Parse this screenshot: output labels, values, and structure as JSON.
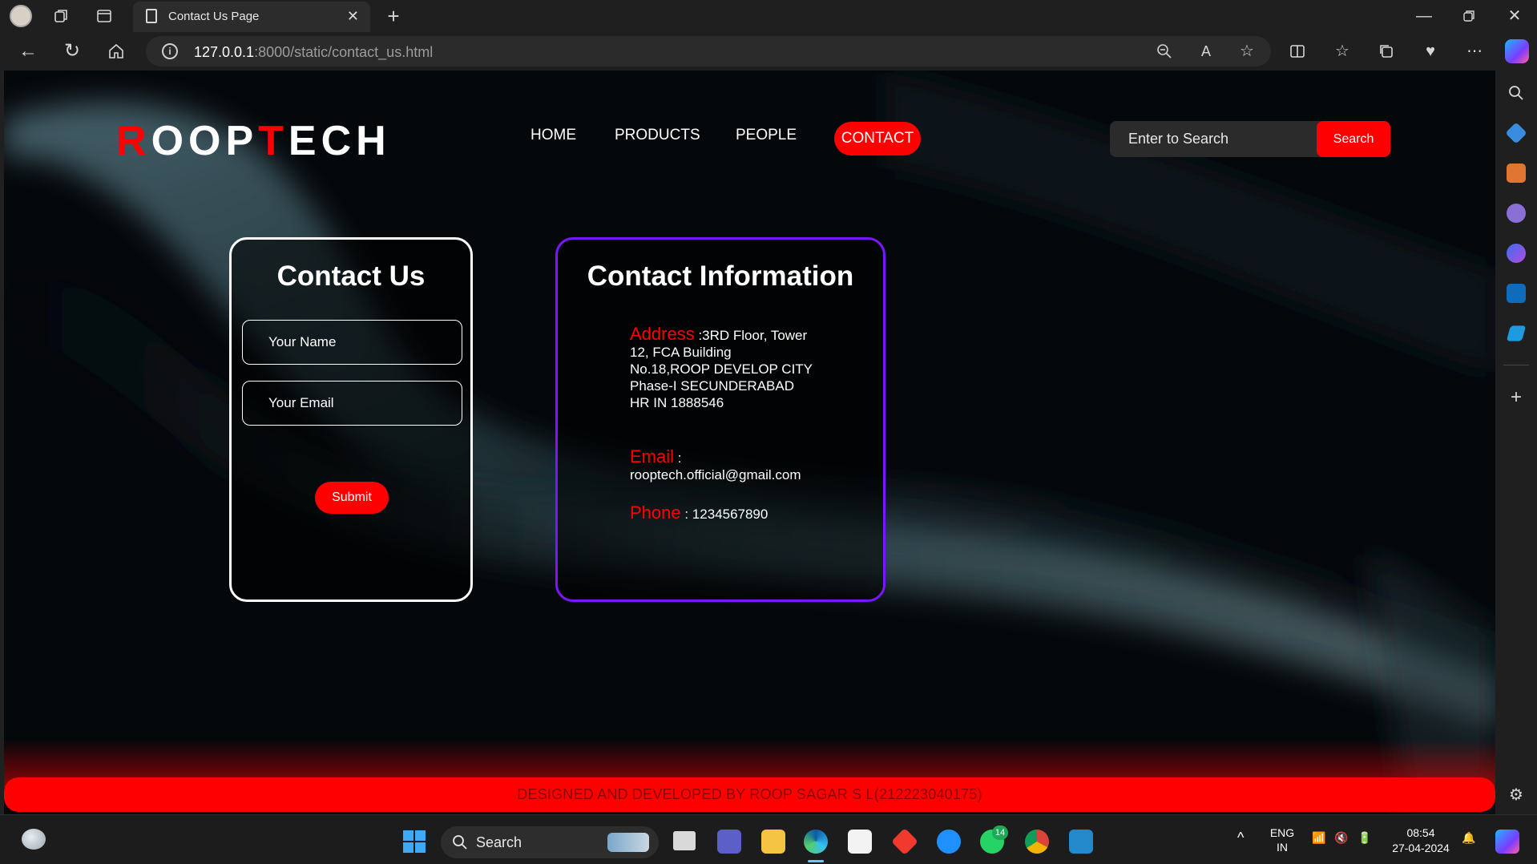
{
  "browser": {
    "tab_title": "Contact Us Page",
    "url_host": "127.0.0.1",
    "url_rest": ":8000/static/contact_us.html"
  },
  "page": {
    "logo_first": "R",
    "logo_mid1": "OOP",
    "logo_red2": "T",
    "logo_rest": "ECH",
    "nav": {
      "home": "HOME",
      "products": "PRODUCTS",
      "people": "PEOPLE",
      "contact": "CONTACT"
    },
    "search": {
      "placeholder": "Enter to Search",
      "button": "Search"
    },
    "contact_form": {
      "title": "Contact Us",
      "name_placeholder": "Your Name",
      "email_placeholder": "Your Email",
      "submit": "Submit"
    },
    "contact_info": {
      "title": "Contact Information",
      "address_label": "Address",
      "address_value": " :3RD Floor, Tower 12, FCA Building No.18,ROOP DEVELOP CITY Phase-I SECUNDERABAD HR IN 1888546",
      "email_label": "Email",
      "email_sep": " :",
      "email_value": "rooptech.official@gmail.com",
      "phone_label": "Phone",
      "phone_value": " : 1234567890"
    },
    "footer": "DESIGNED AND DEVELOPED BY ROOP SAGAR S L(212223040175)"
  },
  "taskbar": {
    "search_label": "Search",
    "lang_top": "ENG",
    "lang_bottom": "IN",
    "time": "08:54",
    "date": "27-04-2024",
    "whatsapp_badge": "14"
  },
  "colors": {
    "accent": "#ff0000",
    "info_border": "#7a16ff"
  }
}
